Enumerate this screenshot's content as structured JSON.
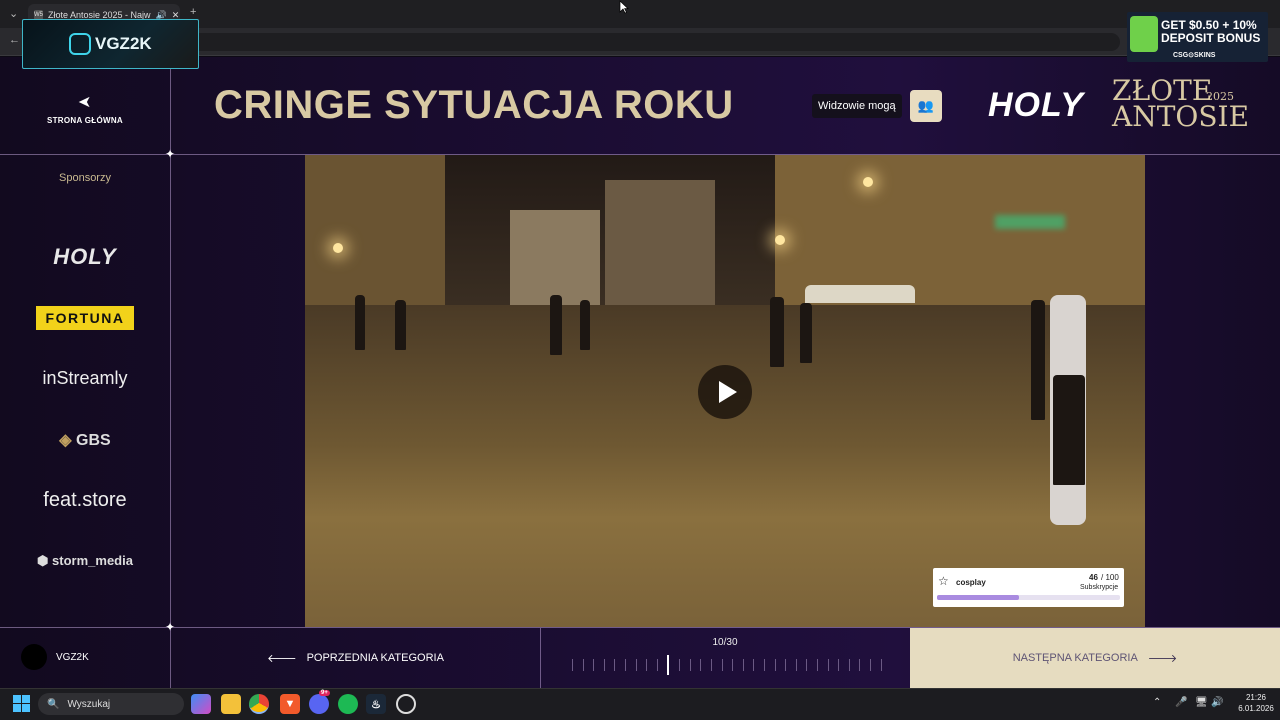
{
  "browser": {
    "tab_title": "Złote Antosie 2025 - Najw",
    "favicon_text": "W5"
  },
  "page": {
    "back_label": "STRONA GŁÓWNA",
    "title": "CRINGE SYTUACJA ROKU",
    "viewers_label": "Widzowie mogą",
    "brand_holy": "HOLY",
    "brand_zlote": "ZŁOTE",
    "brand_antosie": "ANTOSIE",
    "brand_year": "2025"
  },
  "sponsors": {
    "label": "Sponsorzy",
    "items": [
      "HOLY",
      "FORTUNA",
      "inStreamly",
      "GBS",
      "feat.store",
      "storm_media"
    ]
  },
  "subs_widget": {
    "name": "cosplay",
    "current": "46",
    "total": "/ 100",
    "caption": "Subskrypcje",
    "progress_fraction": 0.45
  },
  "navigation": {
    "prev_label": "POPRZEDNIA KATEGORIA",
    "next_label": "NASTĘPNA KATEGORIA",
    "progress_text": "10/30",
    "current_index": 10,
    "total": 30
  },
  "user": {
    "name": "VGZ2K"
  },
  "overlay": {
    "streamer": "VGZ2K",
    "ad_line1": "GET $0.50 + 10%",
    "ad_line2": "DEPOSIT BONUS",
    "ad_brand": "CSG⊙SKINS"
  },
  "taskbar": {
    "search_placeholder": "Wyszukaj",
    "time": "21:26",
    "date": "6.01.2026",
    "discord_badge": "9+"
  },
  "colors": {
    "accent_gold": "#d8c9a3",
    "panel": "#1b0d33",
    "next_bg": "#e6dcc0",
    "fortuna": "#f2d21a"
  }
}
